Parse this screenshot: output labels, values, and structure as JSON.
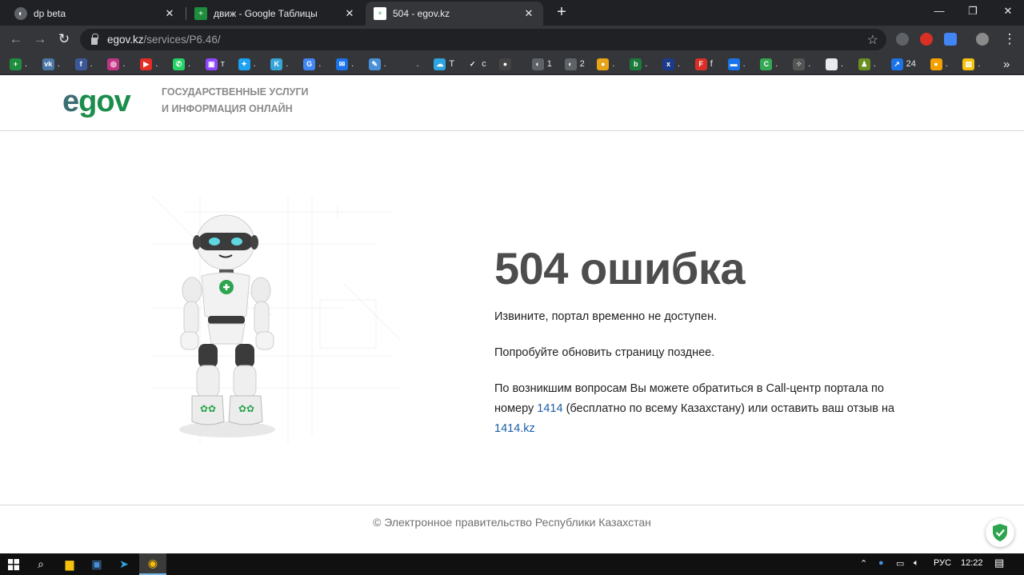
{
  "browser": {
    "tabs": [
      {
        "title": "dp beta",
        "active": false
      },
      {
        "title": "движ - Google Таблицы",
        "active": false
      },
      {
        "title": "504 - egov.kz",
        "active": true
      }
    ],
    "new_tab": "+",
    "url_host": "egov.kz",
    "url_path": "/services/P6.46/",
    "bookmarks": [
      {
        "label": ".",
        "color": "#1e8e3e",
        "glyph": "+"
      },
      {
        "label": ".",
        "color": "#4a76a8",
        "glyph": "vk"
      },
      {
        "label": ".",
        "color": "#3b5998",
        "glyph": "f"
      },
      {
        "label": ".",
        "color": "#c13584",
        "glyph": "◎"
      },
      {
        "label": ".",
        "color": "#e52d27",
        "glyph": "▶"
      },
      {
        "label": ".",
        "color": "#25d366",
        "glyph": "✆"
      },
      {
        "label": "т",
        "color": "#9146ff",
        "glyph": "▣"
      },
      {
        "label": ".",
        "color": "#1da1f2",
        "glyph": "✦"
      },
      {
        "label": ".",
        "color": "#37a5d8",
        "glyph": "K"
      },
      {
        "label": ".",
        "color": "#4285f4",
        "glyph": "G"
      },
      {
        "label": ".",
        "color": "#1a73e8",
        "glyph": "✉"
      },
      {
        "label": ".",
        "color": "#4a90d9",
        "glyph": "✎"
      },
      {
        "label": ".",
        "color": "#35363a",
        "glyph": ""
      },
      {
        "label": "T",
        "color": "#2ca5e0",
        "glyph": "☁"
      },
      {
        "label": "с",
        "color": "#35363a",
        "glyph": "✓"
      },
      {
        "label": "",
        "color": "#444",
        "glyph": "●"
      },
      {
        "label": "1",
        "color": "#5f6368",
        "glyph": "◐"
      },
      {
        "label": "2",
        "color": "#5f6368",
        "glyph": "◐"
      },
      {
        "label": ".",
        "color": "#e8a317",
        "glyph": "●"
      },
      {
        "label": ".",
        "color": "#1b7b3a",
        "glyph": "b"
      },
      {
        "label": ".",
        "color": "#1a3a8a",
        "glyph": "x"
      },
      {
        "label": "f",
        "color": "#d93025",
        "glyph": "F"
      },
      {
        "label": ".",
        "color": "#1a73e8",
        "glyph": "▬"
      },
      {
        "label": ".",
        "color": "#34a853",
        "glyph": "C"
      },
      {
        "label": ".",
        "color": "#555",
        "glyph": "⁘"
      },
      {
        "label": ".",
        "color": "#e8eaed",
        "glyph": "◌"
      },
      {
        "label": ".",
        "color": "#6b8e23",
        "glyph": "♟"
      },
      {
        "label": "24",
        "color": "#1a73e8",
        "glyph": "↗"
      },
      {
        "label": ".",
        "color": "#f4a100",
        "glyph": "●"
      },
      {
        "label": ".",
        "color": "#f4c20d",
        "glyph": "▤"
      }
    ],
    "more": "»"
  },
  "site": {
    "logo_e": "e",
    "logo_gov": "gov",
    "tagline_1": "ГОСУДАРСТВЕННЫЕ УСЛУГИ",
    "tagline_2": "И ИНФОРМАЦИЯ ОНЛАЙН",
    "error_title": "504 ошибка",
    "msg_1": "Извините, портал временно не доступен.",
    "msg_2": "Попробуйте обновить страницу позднее.",
    "msg_3_a": "По возникшим вопросам Вы можете обратиться в Call-центр портала по номеру ",
    "msg_3_phone": "1414",
    "msg_3_b": " (бесплатно по всему Казахстану) или оставить ваш отзыв на ",
    "msg_3_link": "1414.kz",
    "footer": "© Электронное правительство Республики Казахстан"
  },
  "taskbar": {
    "lang": "РУС",
    "time": "12:22"
  },
  "colors": {
    "accent_green": "#1a8d4c",
    "logo_teal": "#3b6e73",
    "link": "#1a5fa8"
  }
}
